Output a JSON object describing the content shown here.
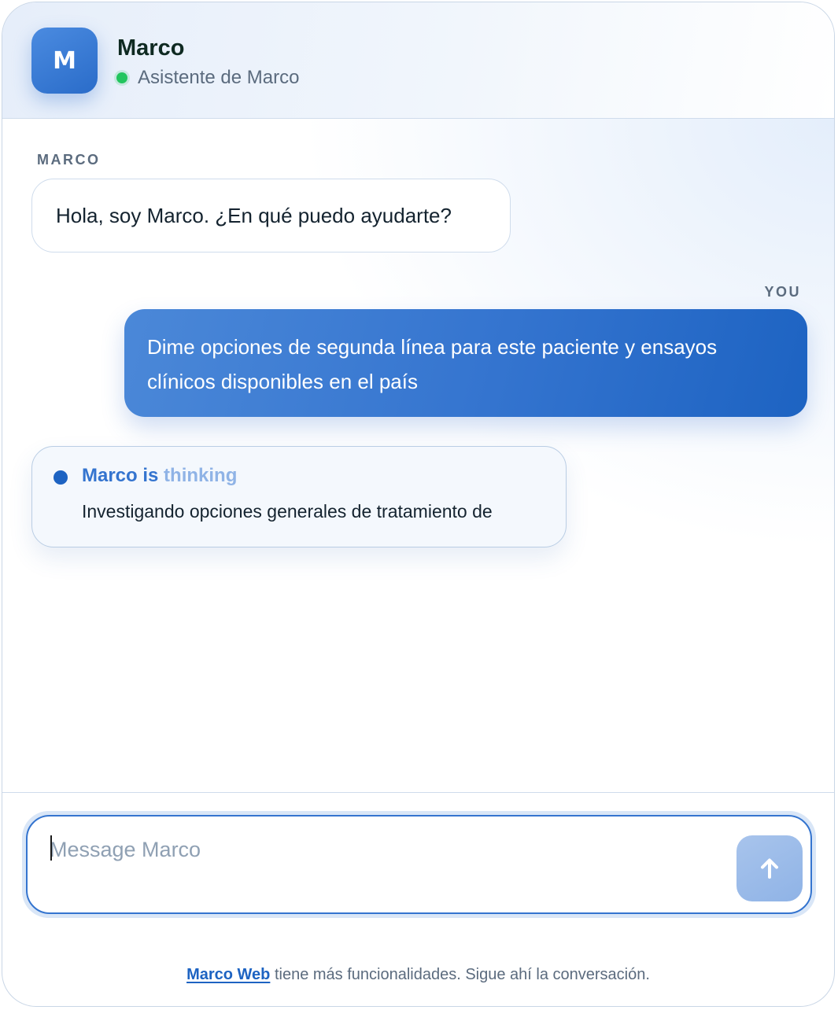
{
  "header": {
    "avatar_letter": "M",
    "name": "Marco",
    "subtitle": "Asistente de Marco",
    "status_color": "#22c55e"
  },
  "messages": [
    {
      "sender_label": "MARCO",
      "text": "Hola, soy Marco. ¿En qué puedo ayudarte?"
    },
    {
      "sender_label": "YOU",
      "text": "Dime opciones de segunda línea para este paciente y ensayos clínicos disponibles en el país"
    }
  ],
  "thinking": {
    "title_solid": "Marco is",
    "title_faded": "thinking",
    "text": "Investigando opciones generales de tratamiento de"
  },
  "composer": {
    "placeholder": "Message Marco",
    "value": "",
    "send_icon": "arrow-up-icon"
  },
  "footer": {
    "link_text": "Marco Web",
    "text": "tiene más funcionalidades. Sigue ahí la conversación."
  },
  "colors": {
    "accent": "#3474cf",
    "accent_dark": "#1d63c2",
    "online": "#22c55e"
  }
}
